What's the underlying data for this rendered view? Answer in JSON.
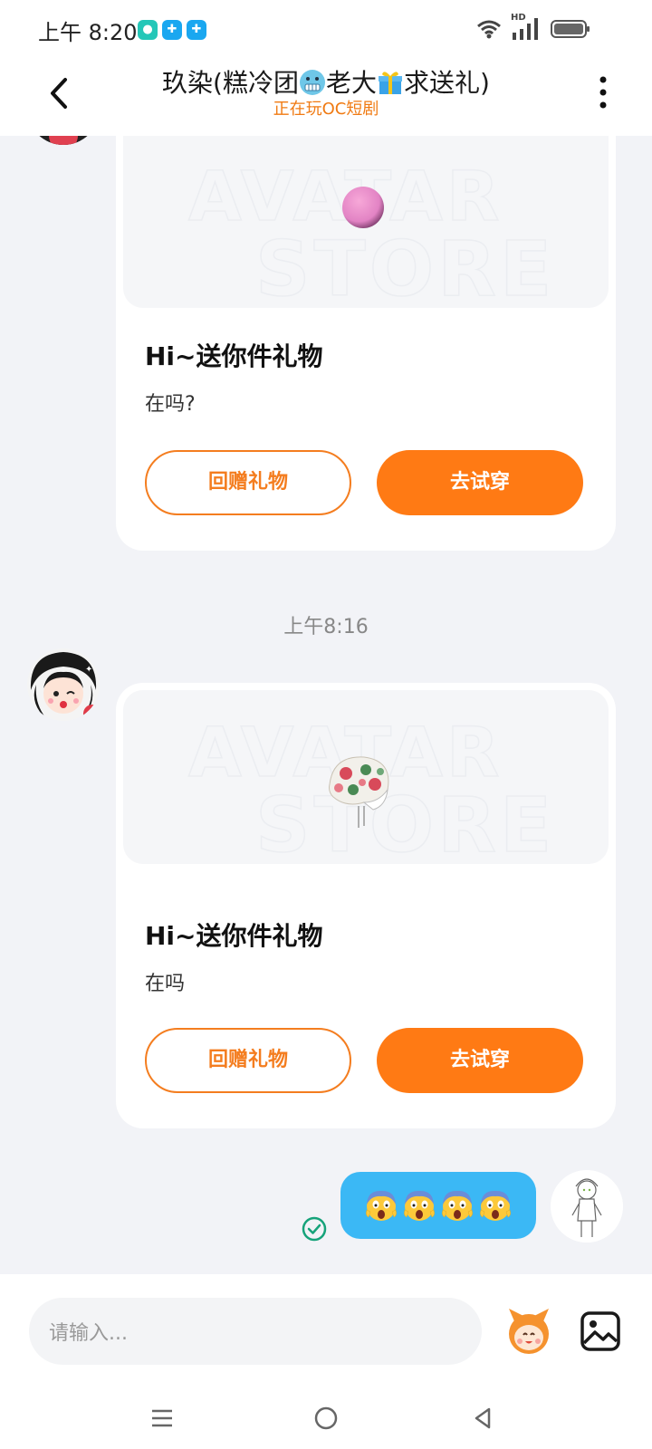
{
  "status_bar": {
    "time": "上午 8:20",
    "notification_icons": [
      "message-app-icon",
      "puzzle-app-icon",
      "puzzle-app-icon"
    ],
    "network_label": "HD",
    "icons": [
      "wifi-icon",
      "signal-icon",
      "battery-icon"
    ]
  },
  "header": {
    "title_part1": "玖染(糕冷团",
    "title_part2": "老大",
    "title_part3": "求送礼)",
    "title_emojis": [
      "cold-face-emoji",
      "gift-emoji"
    ],
    "subtitle": "正在玩OC短剧"
  },
  "messages": [
    {
      "type": "gift_card",
      "watermark_line1": "AVATAR",
      "watermark_line2": "STORE",
      "item": "pink-ball-item",
      "title": "Hi~送你件礼物",
      "text": "在吗?",
      "button_return": "回赠礼物",
      "button_try": "去试穿"
    },
    {
      "type": "timestamp",
      "text": "上午8:16"
    },
    {
      "type": "gift_card",
      "watermark_line1": "AVATAR",
      "watermark_line2": "STORE",
      "item": "floral-beret-item",
      "title": "Hi~送你件礼物",
      "text": "在吗",
      "button_return": "回赠礼物",
      "button_try": "去试穿"
    },
    {
      "type": "sent_text",
      "content": [
        "screaming-face-emoji",
        "screaming-face-emoji",
        "screaming-face-emoji",
        "screaming-face-emoji"
      ],
      "status": "sent-check-icon"
    }
  ],
  "input_bar": {
    "placeholder": "请输入..."
  },
  "colors": {
    "accent_orange": "#ff7a14",
    "bubble_blue": "#3bb8f5",
    "subtitle_orange": "#f07a12",
    "background": "#f2f3f7",
    "check_green": "#16a37a"
  }
}
